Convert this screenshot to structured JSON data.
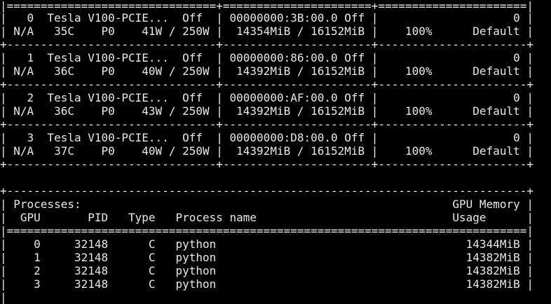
{
  "terminal": {
    "background": "#000000",
    "foreground": "#e8e8e8",
    "lines": [
      "|===============================+======================+======================|",
      "|   0  Tesla V100-PCIE...  Off  | 00000000:3B:00.0 Off |                    0 |",
      "| N/A   35C    P0    41W / 250W |  14354MiB / 16152MiB |    100%      Default |",
      "+-------------------------------+----------------------+----------------------+",
      "|   1  Tesla V100-PCIE...  Off  | 00000000:86:00.0 Off |                    0 |",
      "| N/A   36C    P0    40W / 250W |  14392MiB / 16152MiB |    100%      Default |",
      "+-------------------------------+----------------------+----------------------+",
      "|   2  Tesla V100-PCIE...  Off  | 00000000:AF:00.0 Off |                    0 |",
      "| N/A   36C    P0    43W / 250W |  14392MiB / 16152MiB |    100%      Default |",
      "+-------------------------------+----------------------+----------------------+",
      "|   3  Tesla V100-PCIE...  Off  | 00000000:D8:00.0 Off |                    0 |",
      "| N/A   37C    P0    40W / 250W |  14392MiB / 16152MiB |    100%      Default |",
      "+-------------------------------+----------------------+----------------------+",
      "",
      "+-----------------------------------------------------------------------------+",
      "| Processes:                                                       GPU Memory |",
      "|  GPU       PID   Type   Process name                             Usage      |",
      "|=============================================================================|",
      "|    0     32148      C   python                                     14344MiB |",
      "|    1     32148      C   python                                     14382MiB |",
      "|    2     32148      C   python                                     14382MiB |",
      "|    3     32148      C   python                                     14382MiB |",
      "|                                                                              "
    ]
  }
}
